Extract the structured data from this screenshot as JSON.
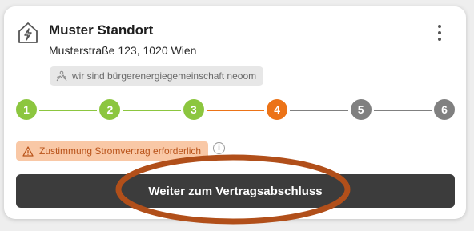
{
  "location": {
    "title": "Muster Standort",
    "address": "Musterstraße 123, 1020 Wien",
    "icon": "house-bolt-icon"
  },
  "menu": {
    "icon": "more-vertical-icon"
  },
  "community_tag": {
    "label": "wir sind bürgerenergiegemeinschaft neoom",
    "icon": "community-icon"
  },
  "stepper": {
    "current_step": 4,
    "steps": [
      {
        "label": "1",
        "status": "done"
      },
      {
        "label": "2",
        "status": "done"
      },
      {
        "label": "3",
        "status": "done"
      },
      {
        "label": "4",
        "status": "current"
      },
      {
        "label": "5",
        "status": "pending"
      },
      {
        "label": "6",
        "status": "pending"
      }
    ],
    "colors": {
      "done": "#8cc63f",
      "current": "#ec7317",
      "pending": "#808080"
    }
  },
  "warning": {
    "label": "Zustimmung Stromvertrag erforderlich",
    "icon": "warning-triangle-icon",
    "color": "#b9531a",
    "background": "#f9c8a6"
  },
  "info": {
    "icon": "info-icon",
    "glyph": "i"
  },
  "cta": {
    "label": "Weiter zum Vertragsabschluss",
    "background": "#3c3c3c"
  },
  "annotation": {
    "color": "#b14f1a"
  }
}
